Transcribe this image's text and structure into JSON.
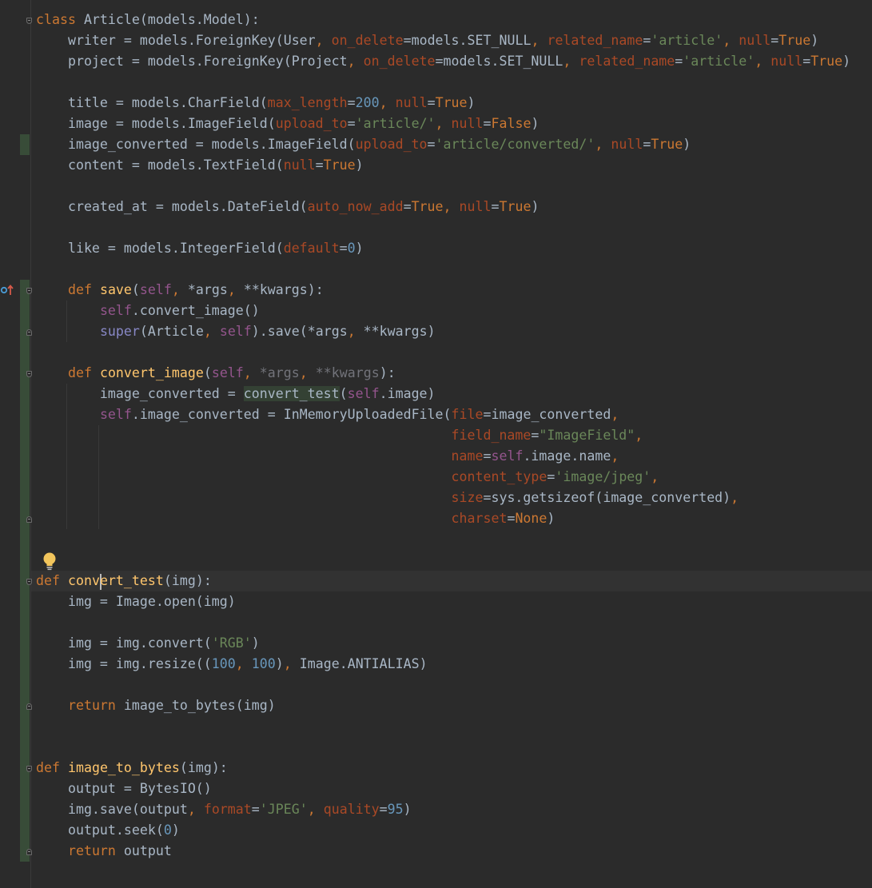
{
  "editor": {
    "language": "python",
    "caret_line": 28,
    "lines": [
      "class Article(models.Model):",
      "    writer = models.ForeignKey(User, on_delete=models.SET_NULL, related_name='article', null=True)",
      "    project = models.ForeignKey(Project, on_delete=models.SET_NULL, related_name='article', null=True)",
      "",
      "    title = models.CharField(max_length=200, null=True)",
      "    image = models.ImageField(upload_to='article/', null=False)",
      "    image_converted = models.ImageField(upload_to='article/converted/', null=True)",
      "    content = models.TextField(null=True)",
      "",
      "    created_at = models.DateField(auto_now_add=True, null=True)",
      "",
      "    like = models.IntegerField(default=0)",
      "",
      "    def save(self, *args, **kwargs):",
      "        self.convert_image()",
      "        super(Article, self).save(*args, **kwargs)",
      "",
      "    def convert_image(self, *args, **kwargs):",
      "        image_converted = convert_test(self.image)",
      "        self.image_converted = InMemoryUploadedFile(file=image_converted,",
      "                                                    field_name=\"ImageField\",",
      "                                                    name=self.image.name,",
      "                                                    content_type='image/jpeg',",
      "                                                    size=sys.getsizeof(image_converted),",
      "                                                    charset=None)",
      "",
      "",
      "def convert_test(img):",
      "    img = Image.open(img)",
      "",
      "    img = img.convert('RGB')",
      "    img = img.resize((100, 100), Image.ANTIALIAS)",
      "",
      "    return image_to_bytes(img)",
      "",
      "",
      "def image_to_bytes(img):",
      "    output = BytesIO()",
      "    img.save(output, format='JPEG', quality=95)",
      "    output.seek(0)",
      "    return output"
    ]
  },
  "gutter": {
    "override_marker": "override-method-icon",
    "intention_action": "lightbulb-icon"
  },
  "colors": {
    "background": "#2b2b2b",
    "current_line": "#323232",
    "text": "#a9b7c6",
    "keyword": "#cc7832",
    "function": "#ffc66d",
    "self": "#94558d",
    "string": "#6a8759",
    "number": "#6897bb",
    "keyword_arg": "#aa4926",
    "vcs_added": "#384c38"
  }
}
